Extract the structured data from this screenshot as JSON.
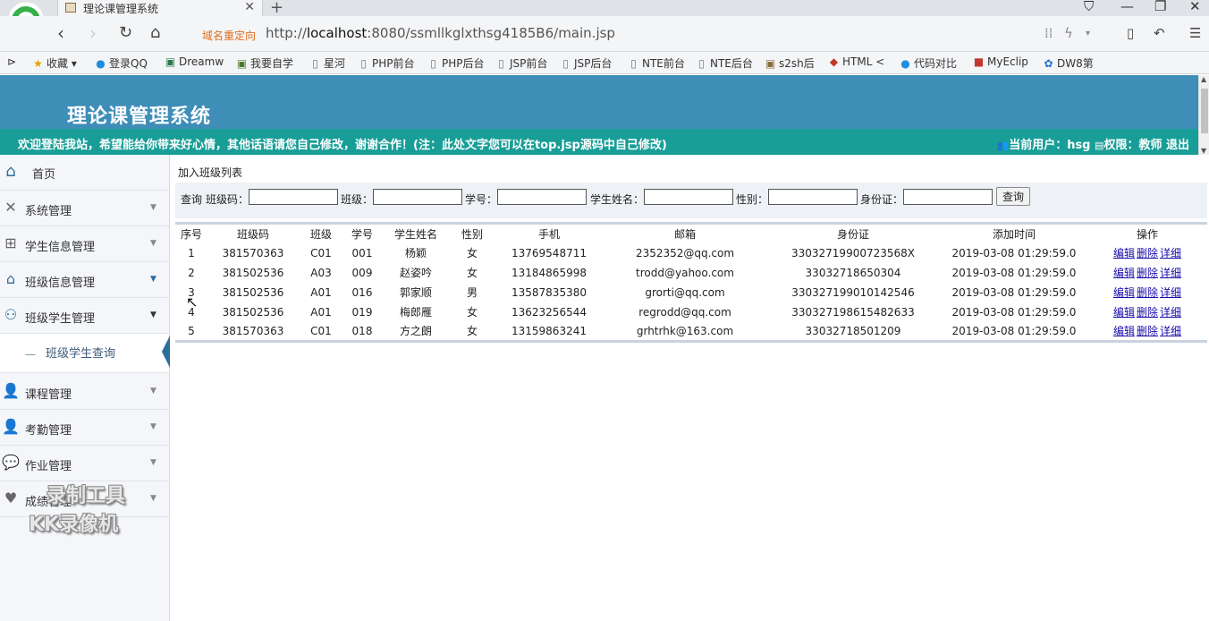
{
  "browser": {
    "tab_title": "理论课管理系统",
    "redirect_label": "域名重定向",
    "url_prefix": "http://",
    "url_host": "localhost",
    "url_rest": ":8080/ssmllkglxthsg4185B6/main.jsp",
    "bookmarks": [
      "收藏",
      "登录QQ",
      "Dreamw",
      "我要自学",
      "星河",
      "PHP前台",
      "PHP后台",
      "JSP前台",
      "JSP后台",
      "NTE前台",
      "NTE后台",
      "s2sh后",
      "HTML <",
      "代码对比",
      "MyEclip",
      "DW8第"
    ]
  },
  "header": {
    "title": "理论课管理系统",
    "welcome": "欢迎登陆我站，希望能给你带来好心情，其他话语请您自己修改，谢谢合作！(注：此处文字您可以在top.jsp源码中自己修改)",
    "user_label": "当前用户：hsg",
    "role_label": "权限：教师",
    "logout": "退出"
  },
  "sidebar": {
    "items": [
      {
        "label": "首页",
        "icon": "home-icon"
      },
      {
        "label": "系统管理",
        "icon": "tools-icon"
      },
      {
        "label": "学生信息管理",
        "icon": "grid-icon"
      },
      {
        "label": "班级信息管理",
        "icon": "house-icon"
      },
      {
        "label": "班级学生管理",
        "icon": "user-icon"
      },
      {
        "label": "课程管理",
        "icon": "person-icon"
      },
      {
        "label": "考勤管理",
        "icon": "person-icon"
      },
      {
        "label": "作业管理",
        "icon": "chat-icon"
      },
      {
        "label": "成绩管理",
        "icon": "heart-icon"
      }
    ],
    "submenu_label": "班级学生查询"
  },
  "content": {
    "title": "加入班级列表",
    "search": {
      "prefix": "查询",
      "class_code_label": "班级码：",
      "class_label": "班级：",
      "student_no_label": "学号：",
      "student_name_label": "学生姓名：",
      "gender_label": "性别：",
      "id_card_label": "身份证：",
      "button": "查询"
    },
    "columns": [
      "序号",
      "班级码",
      "班级",
      "学号",
      "学生姓名",
      "性别",
      "手机",
      "邮箱",
      "身份证",
      "添加时间",
      "操作"
    ],
    "rows": [
      [
        "1",
        "381570363",
        "C01",
        "001",
        "杨颖",
        "女",
        "13769548711",
        "2352352@qq.com",
        "33032719900723568X",
        "2019-03-08 01:29:59.0"
      ],
      [
        "2",
        "381502536",
        "A03",
        "009",
        "赵姿吟",
        "女",
        "13184865998",
        "trodd@yahoo.com",
        "33032718650304",
        "2019-03-08 01:29:59.0"
      ],
      [
        "3",
        "381502536",
        "A01",
        "016",
        "郭家顺",
        "男",
        "13587835380",
        "grorti@qq.com",
        "330327199010142546",
        "2019-03-08 01:29:59.0"
      ],
      [
        "4",
        "381502536",
        "A01",
        "019",
        "梅郎雁",
        "女",
        "13623256544",
        "regrodd@qq.com",
        "330327198615482633",
        "2019-03-08 01:29:59.0"
      ],
      [
        "5",
        "381570363",
        "C01",
        "018",
        "方之朗",
        "女",
        "13159863241",
        "grhtrhk@163.com",
        "33032718501209",
        "2019-03-08 01:29:59.0"
      ]
    ],
    "actions": [
      "编辑",
      "删除",
      "详细"
    ]
  },
  "watermark": {
    "line1": "录制工具",
    "line2": "KK录像机"
  }
}
